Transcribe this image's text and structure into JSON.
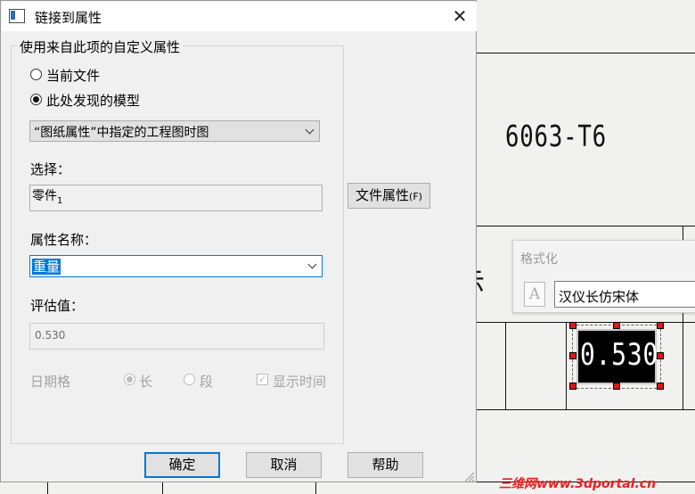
{
  "dialog": {
    "title": "链接到属性",
    "close_glyph": "✕",
    "group_label": "使用来自此项的自定义属性",
    "radio_current": "当前文件",
    "radio_model": "此处发现的模型",
    "model_source_select": "“图纸属性”中指定的工程图时图",
    "selection_label": "选择：",
    "selection_value": "零件",
    "selection_suffix": "1",
    "file_props_button": "文件属性",
    "file_props_hotkey": "(F)",
    "property_name_label": "属性名称：",
    "property_name_value": "重量",
    "evaluated_label": "评估值：",
    "evaluated_value": "0.530",
    "date_format_label": "日期格",
    "date_long": "长",
    "date_short": "段",
    "show_time": "显示时间",
    "ok_button": "确定",
    "cancel_button": "取消",
    "help_button": "帮助"
  },
  "drawing": {
    "material_text": "6063-T6",
    "partial_glyphs": "示 讠",
    "selected_note_text": "0.530"
  },
  "format_popup": {
    "title": "格式化",
    "font_icon": "A",
    "font_name": "汉仪长仿宋体"
  },
  "watermark": "三维网www.3dportal.cn",
  "colors": {
    "accent": "#0078d7",
    "handle": "#d41a1a",
    "watermark": "#e62222"
  }
}
